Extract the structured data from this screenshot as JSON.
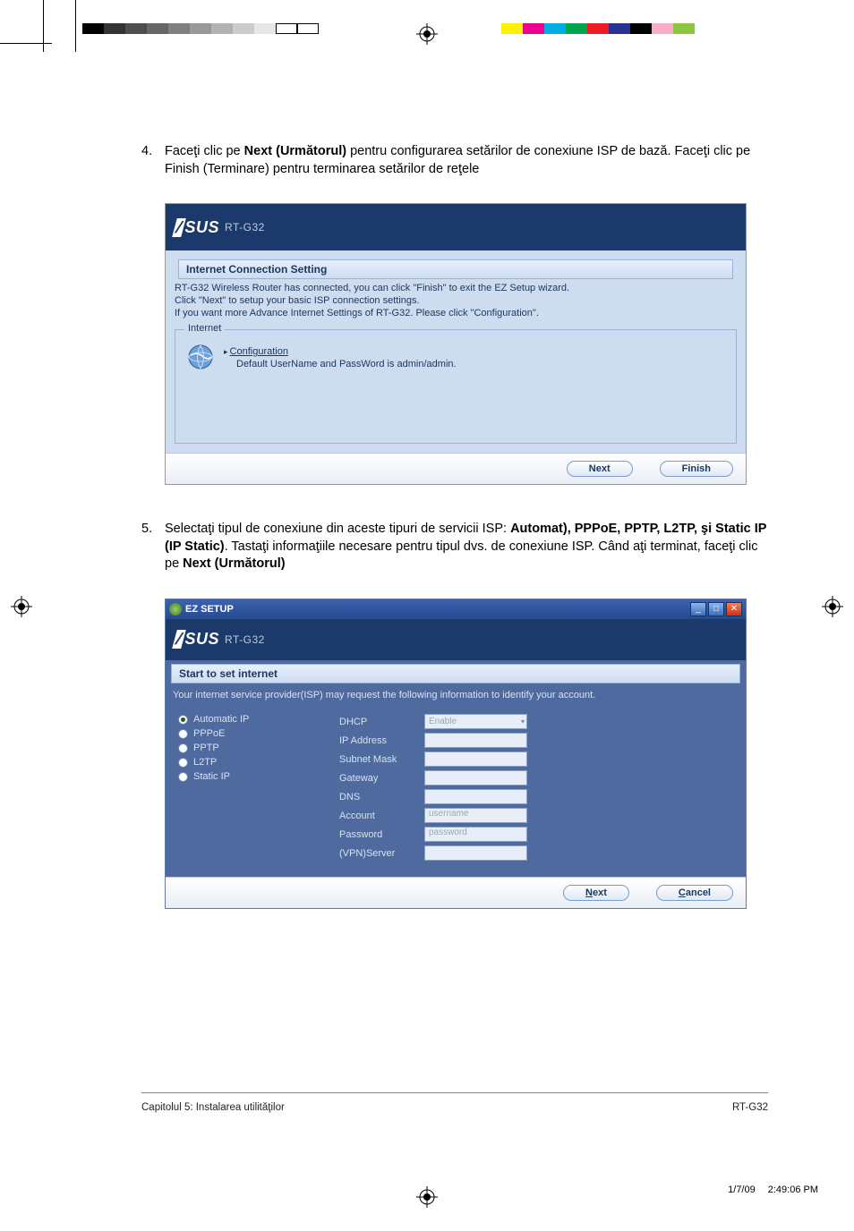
{
  "crop": {
    "colors_left": [
      "#000",
      "#333",
      "#666",
      "#999",
      "#ccc",
      "#fff"
    ],
    "colors_right": [
      "#00aee6",
      "#00a54f",
      "#fff200",
      "#ec008c",
      "#000",
      "#f7adc9",
      "#8dc63f"
    ]
  },
  "steps": {
    "s4": {
      "num": "4.",
      "text_before": "Faceţi clic pe ",
      "bold1": "Next (Următorul)",
      "text_mid": " pentru configurarea setărilor de conexiune ISP de bază. Faceţi clic pe Finish (Terminare) pentru terminarea setărilor de reţele"
    },
    "s5": {
      "num": "5.",
      "text_before": "Selectaţi tipul de conexiune din aceste tipuri de servicii ISP: ",
      "bold1": "Automat), PPPoE, PPTP, L2TP, şi Static IP (IP Static)",
      "text_mid": ". Tastaţi informaţiile necesare pentru tipul dvs. de conexiune ISP. Când aţi terminat, faceţi clic pe ",
      "bold2": "Next (Următorul)"
    }
  },
  "shot1": {
    "model": "RT-G32",
    "section": "Internet Connection Setting",
    "line1": "RT-G32 Wireless Router has connected, you can click \"Finish\" to exit the EZ Setup wizard.",
    "line2": "Click \"Next\" to setup your basic ISP connection settings.",
    "line3": "If you want more Advance Internet Settings of RT-G32. Please click \"Configuration\".",
    "fieldset_legend": "Internet",
    "config_link": "Configuration",
    "config_text": "Default UserName and PassWord is admin/admin.",
    "btn_next": "Next",
    "btn_finish": "Finish"
  },
  "shot2": {
    "win_title": "EZ SETUP",
    "model": "RT-G32",
    "section": "Start to set internet",
    "isp_text": "Your internet service provider(ISP) may request the following information to identify your account.",
    "radios": {
      "auto": "Automatic IP",
      "pppoe": "PPPoE",
      "pptp": "PPTP",
      "l2tp": "L2TP",
      "static": "Static IP"
    },
    "fields": {
      "dhcp": "DHCP",
      "dhcp_value": "Enable",
      "ip": "IP Address",
      "subnet": "Subnet Mask",
      "gateway": "Gateway",
      "dns": "DNS",
      "account": "Account",
      "account_ph": "username",
      "password": "Password",
      "password_ph": "password",
      "vpn": "(VPN)Server"
    },
    "btn_next": "Next",
    "btn_cancel": "Cancel"
  },
  "footer": {
    "left": "Capitolul 5: Instalarea utilităţilor",
    "right": "RT-G32"
  },
  "print": {
    "date": "1/7/09",
    "time": "2:49:06 PM"
  }
}
